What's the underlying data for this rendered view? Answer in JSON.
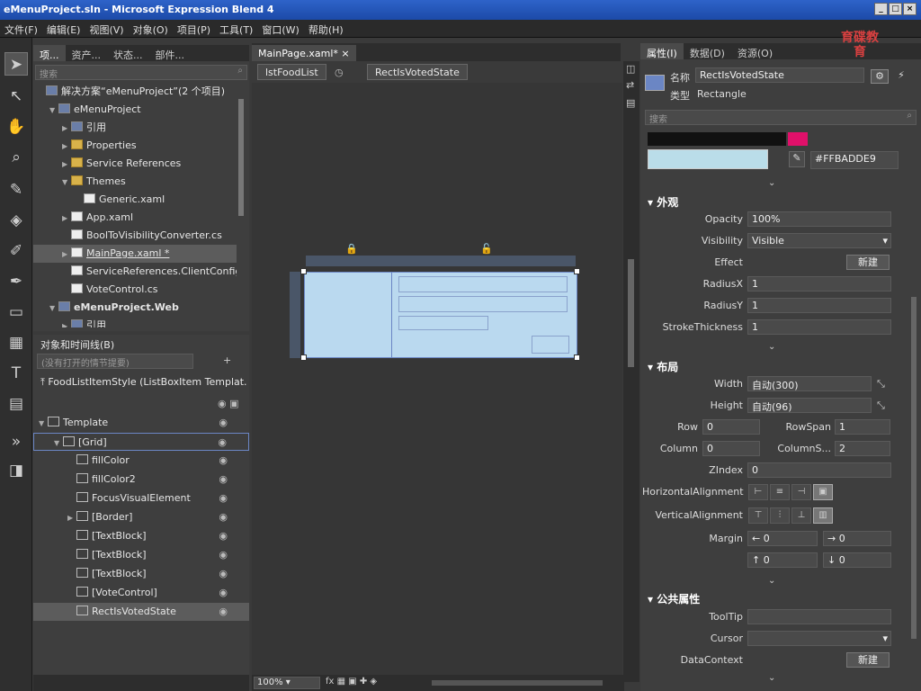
{
  "window": {
    "title": "eMenuProject.sln - Microsoft Expression Blend 4"
  },
  "menu": [
    "文件(F)",
    "编辑(E)",
    "视图(V)",
    "对象(O)",
    "项目(P)",
    "工具(T)",
    "窗口(W)",
    "帮助(H)"
  ],
  "project_panel": {
    "tabs": [
      "项...",
      "资产...",
      "状态...",
      "部件..."
    ],
    "search_placeholder": "搜索",
    "items": [
      {
        "label": "解决方案“eMenuProject”(2 个项目)",
        "indent": 0,
        "icon": "solution-icon",
        "arrow": ""
      },
      {
        "label": "eMenuProject",
        "indent": 1,
        "icon": "project-icon",
        "arrow": "▼"
      },
      {
        "label": "引用",
        "indent": 2,
        "icon": "references-icon",
        "arrow": "▶"
      },
      {
        "label": "Properties",
        "indent": 2,
        "icon": "folder-icon",
        "arrow": "▶"
      },
      {
        "label": "Service References",
        "indent": 2,
        "icon": "folder-icon",
        "arrow": "▶"
      },
      {
        "label": "Themes",
        "indent": 2,
        "icon": "folder-open-icon",
        "arrow": "▼"
      },
      {
        "label": "Generic.xaml",
        "indent": 3,
        "icon": "xaml-file-icon",
        "arrow": ""
      },
      {
        "label": "App.xaml",
        "indent": 2,
        "icon": "xaml-file-icon",
        "arrow": "▶"
      },
      {
        "label": "BoolToVisibilityConverter.cs",
        "indent": 2,
        "icon": "cs-file-icon",
        "arrow": ""
      },
      {
        "label": "MainPage.xaml *",
        "indent": 2,
        "icon": "xaml-file-icon",
        "arrow": "▶",
        "selected": true
      },
      {
        "label": "ServiceReferences.ClientConfig",
        "indent": 2,
        "icon": "config-file-icon",
        "arrow": ""
      },
      {
        "label": "VoteControl.cs",
        "indent": 2,
        "icon": "cs-file-icon",
        "arrow": ""
      },
      {
        "label": "eMenuProject.Web",
        "indent": 1,
        "icon": "project-icon",
        "arrow": "▼",
        "bold": true
      },
      {
        "label": "引用",
        "indent": 2,
        "icon": "references-icon",
        "arrow": "▶"
      }
    ]
  },
  "objects_panel": {
    "title": "对象和时间线(B)",
    "search_placeholder": "(没有打开的情节提要)",
    "scope": "FoodListItemStyle (ListBoxItem Templat...",
    "items": [
      {
        "label": "Template",
        "indent": 0,
        "icon": "template-icon",
        "arrow": "▼"
      },
      {
        "label": "[Grid]",
        "indent": 1,
        "icon": "grid-icon",
        "arrow": "▼",
        "outlined": true
      },
      {
        "label": "fillColor",
        "indent": 2,
        "icon": "rectangle-icon",
        "arrow": ""
      },
      {
        "label": "fillColor2",
        "indent": 2,
        "icon": "rectangle-icon",
        "arrow": ""
      },
      {
        "label": "FocusVisualElement",
        "indent": 2,
        "icon": "rectangle-icon",
        "arrow": ""
      },
      {
        "label": "[Border]",
        "indent": 2,
        "icon": "border-icon",
        "arrow": "▶"
      },
      {
        "label": "[TextBlock]",
        "indent": 2,
        "icon": "textblock-icon",
        "arrow": ""
      },
      {
        "label": "[TextBlock]",
        "indent": 2,
        "icon": "textblock-icon",
        "arrow": ""
      },
      {
        "label": "[TextBlock]",
        "indent": 2,
        "icon": "textblock-icon",
        "arrow": ""
      },
      {
        "label": "[VoteControl]",
        "indent": 2,
        "icon": "control-icon",
        "arrow": ""
      },
      {
        "label": "RectIsVotedState",
        "indent": 2,
        "icon": "rectangle-icon",
        "arrow": "",
        "selected": true
      }
    ]
  },
  "document": {
    "tab": "MainPage.xaml*",
    "breadcrumbs": [
      "lstFoodList",
      "RectIsVotedState"
    ],
    "zoom": "100%"
  },
  "properties_panel": {
    "tabs": [
      "属性(I)",
      "数据(D)",
      "资源(O)"
    ],
    "name_label": "名称",
    "name_value": "RectIsVotedState",
    "type_label": "类型",
    "type_value": "Rectangle",
    "search_placeholder": "搜索",
    "color_hex": "#FFBADDE9",
    "sections": {
      "appearance": "外观",
      "layout": "布局",
      "common": "公共属性"
    },
    "appearance": {
      "opacity_label": "Opacity",
      "opacity": "100%",
      "visibility_label": "Visibility",
      "visibility": "Visible",
      "effect_label": "Effect",
      "effect_button": "新建",
      "radiusx_label": "RadiusX",
      "radiusx": "1",
      "radiusy_label": "RadiusY",
      "radiusy": "1",
      "stroke_label": "StrokeThickness",
      "stroke": "1"
    },
    "layout": {
      "width_label": "Width",
      "width": "自动(300)",
      "height_label": "Height",
      "height": "自动(96)",
      "row_label": "Row",
      "row": "0",
      "rowspan_label": "RowSpan",
      "rowspan": "1",
      "column_label": "Column",
      "column": "0",
      "columnspan_label": "ColumnS...",
      "columnspan": "2",
      "zindex_label": "ZIndex",
      "zindex": "0",
      "halign_label": "HorizontalAlignment",
      "valign_label": "VerticalAlignment",
      "margin_label": "Margin",
      "margin": {
        "left": "0",
        "right": "0",
        "top": "0",
        "bottom": "0"
      }
    },
    "common": {
      "tooltip_label": "ToolTip",
      "cursor_label": "Cursor",
      "datacontext_label": "DataContext",
      "datacontext_button": "新建"
    }
  },
  "watermark": "育碟教育",
  "colors": {
    "accent": "#bad de9",
    "selection": "#ffbadde9"
  }
}
